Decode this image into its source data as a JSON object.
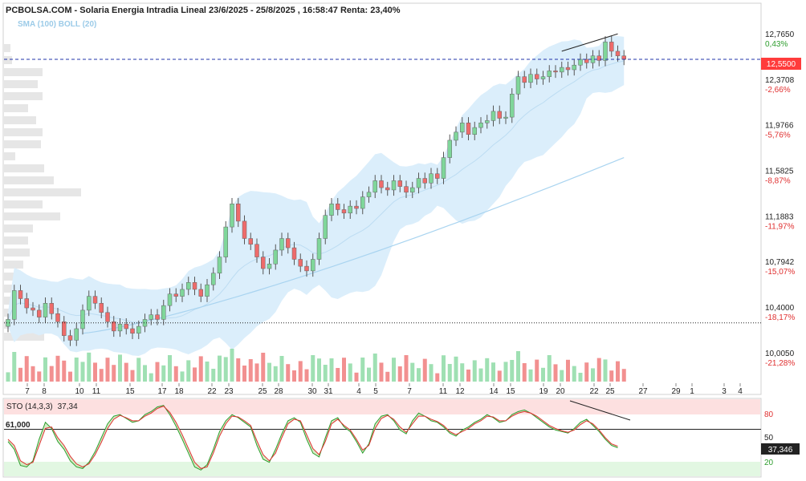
{
  "header": {
    "title": "PCBOLSA.COM - Solaria Energia Intradia Lineal 23/6/2025 - 25/8/2025 , 16:58:47 Renta: 23,40%",
    "indicators": "SMA (100) BOLL (20)"
  },
  "colors": {
    "up": "#7fd69a",
    "down": "#ee6b6b",
    "band": "#dbeefb",
    "sma": "#a9d4f0",
    "current": "#ff3b3b",
    "stoK": "#2e9d2e",
    "stoD": "#e03030"
  },
  "chart_data": [
    {
      "type": "candlestick",
      "title": "PCBOLSA.COM - Solaria Energia Intradia Lineal 23/6/2025 - 25/8/2025 , 16:58:47 Renta: 23,40%",
      "ylim": [
        9.85,
        12.85
      ],
      "current_price": "12,5500",
      "price_ticks": [
        {
          "v": 12.765,
          "label": "12,7650",
          "pct": "0,43%"
        },
        {
          "v": 12.3708,
          "label": "12,3708",
          "pct": "-2,66%"
        },
        {
          "v": 11.9766,
          "label": "11,9766",
          "pct": "-5,76%"
        },
        {
          "v": 11.5825,
          "label": "11,5825",
          "pct": "-8,87%"
        },
        {
          "v": 11.1883,
          "label": "11,1883",
          "pct": "-11,97%"
        },
        {
          "v": 10.7942,
          "label": "10,7942",
          "pct": "-15,07%"
        },
        {
          "v": 10.4,
          "label": "10,4000",
          "pct": "-18,17%"
        },
        {
          "v": 10.005,
          "label": "10,0050",
          "pct": "-21,28%"
        }
      ],
      "reference_line": 10.27,
      "x_ticks": [
        "7",
        "8",
        "10",
        "11",
        "15",
        "17",
        "18",
        "22",
        "23",
        "25",
        "28",
        "30",
        "31",
        "4",
        "5",
        "7",
        "11",
        "12",
        "14",
        "15",
        "19",
        "20",
        "22",
        "25",
        "27",
        "29",
        "1",
        "3",
        "4"
      ],
      "closes": [
        10.3,
        10.55,
        10.48,
        10.4,
        10.38,
        10.32,
        10.44,
        10.35,
        10.28,
        10.16,
        10.12,
        10.22,
        10.38,
        10.5,
        10.44,
        10.36,
        10.28,
        10.2,
        10.26,
        10.22,
        10.18,
        10.24,
        10.3,
        10.34,
        10.3,
        10.42,
        10.52,
        10.5,
        10.56,
        10.62,
        10.56,
        10.5,
        10.6,
        10.7,
        10.84,
        11.1,
        11.3,
        11.15,
        11.0,
        10.95,
        10.84,
        10.74,
        10.78,
        10.9,
        11.0,
        10.92,
        10.82,
        10.76,
        10.72,
        10.82,
        11.0,
        11.2,
        11.3,
        11.25,
        11.22,
        11.28,
        11.26,
        11.36,
        11.4,
        11.5,
        11.44,
        11.42,
        11.5,
        11.45,
        11.4,
        11.44,
        11.52,
        11.48,
        11.56,
        11.52,
        11.7,
        11.85,
        11.92,
        12.0,
        11.9,
        11.96,
        12.0,
        12.02,
        12.1,
        12.04,
        12.05,
        12.25,
        12.4,
        12.35,
        12.42,
        12.38,
        12.4,
        12.45,
        12.44,
        12.48,
        12.46,
        12.5,
        12.55,
        12.52,
        12.58,
        12.54,
        12.7,
        12.62,
        12.58,
        12.55
      ],
      "volume_ticks": "none"
    },
    {
      "type": "line",
      "title": "STO (14,3,3)",
      "header_value": "37,34",
      "current_value": "37,346",
      "marked_level": "61,000",
      "ylim": [
        0,
        100
      ],
      "y_ticks": [
        "80",
        "50",
        "20"
      ],
      "series": [
        {
          "values": [
            45,
            35,
            14,
            12,
            20,
            48,
            70,
            62,
            45,
            35,
            20,
            12,
            10,
            18,
            32,
            50,
            68,
            78,
            80,
            75,
            70,
            72,
            80,
            84,
            90,
            92,
            80,
            65,
            48,
            30,
            12,
            8,
            15,
            35,
            58,
            72,
            80,
            76,
            70,
            64,
            40,
            22,
            18,
            35,
            55,
            72,
            76,
            70,
            48,
            30,
            25,
            50,
            72,
            76,
            64,
            58,
            45,
            30,
            42,
            68,
            78,
            80,
            72,
            60,
            55,
            72,
            82,
            78,
            72,
            70,
            64,
            56,
            52,
            60,
            64,
            70,
            74,
            80,
            76,
            70,
            72,
            80,
            84,
            86,
            82,
            76,
            70,
            64,
            60,
            58,
            56,
            62,
            70,
            74,
            66,
            58,
            48,
            40,
            37
          ]
        },
        {
          "values": [
            48,
            40,
            20,
            15,
            18,
            40,
            62,
            64,
            50,
            40,
            26,
            16,
            12,
            16,
            28,
            44,
            62,
            74,
            79,
            76,
            72,
            72,
            78,
            82,
            88,
            91,
            83,
            70,
            54,
            36,
            18,
            10,
            12,
            30,
            52,
            68,
            78,
            77,
            72,
            66,
            46,
            28,
            20,
            30,
            50,
            68,
            74,
            72,
            54,
            36,
            28,
            45,
            68,
            74,
            66,
            60,
            48,
            34,
            40,
            62,
            75,
            79,
            74,
            64,
            57,
            68,
            78,
            78,
            74,
            71,
            66,
            58,
            54,
            58,
            62,
            68,
            72,
            78,
            77,
            72,
            72,
            78,
            82,
            84,
            82,
            78,
            72,
            66,
            62,
            59,
            57,
            60,
            67,
            72,
            68,
            60,
            50,
            42,
            39
          ]
        }
      ]
    }
  ]
}
